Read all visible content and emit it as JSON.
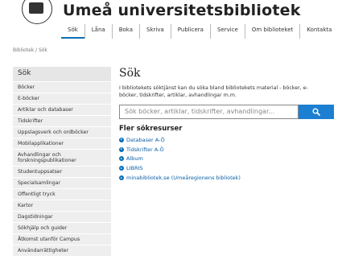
{
  "site": {
    "title": "Umeå universitetsbibliotek"
  },
  "topnav": [
    "Sök",
    "Låna",
    "Boka",
    "Skriva",
    "Publicera",
    "Service",
    "Om biblioteket",
    "Kontakta"
  ],
  "breadcrumb": "Bibliotek / Sök",
  "sidebar": {
    "title": "Sök",
    "items": [
      "Böcker",
      "E-böcker",
      "Artiklar och databaser",
      "Tidskrifter",
      "Uppslagsverk och ordböcker",
      "Mobilapplikationer",
      "Avhandlingar och forskningspublikationer",
      "Studentuppsatser",
      "Specialsamlingar",
      "Offentligt tryck",
      "Kartor",
      "Dagstidningar",
      "Sökhjälp och guider",
      "Åtkomst utanför Campus",
      "Användarrättigheter"
    ]
  },
  "main": {
    "title": "Sök",
    "intro": "I bibliotekets söktjänst kan du söka bland bibliotekets material - böcker, e-böcker, tidskrifter, artiklar, avhandlingar m.m.",
    "search_placeholder": "Sök böcker, artiklar, tidskrifter, avhandlingar...",
    "resources_title": "Fler sökresurser",
    "resources": [
      "Databaser A-Ö",
      "Tidskrifter A-Ö",
      "Album",
      "LIBRIS",
      "minabibliotek.se (Umeåregionens bibliotek)"
    ]
  },
  "colors": {
    "accent": "#1d7fd1",
    "link": "#0a5fa8"
  }
}
